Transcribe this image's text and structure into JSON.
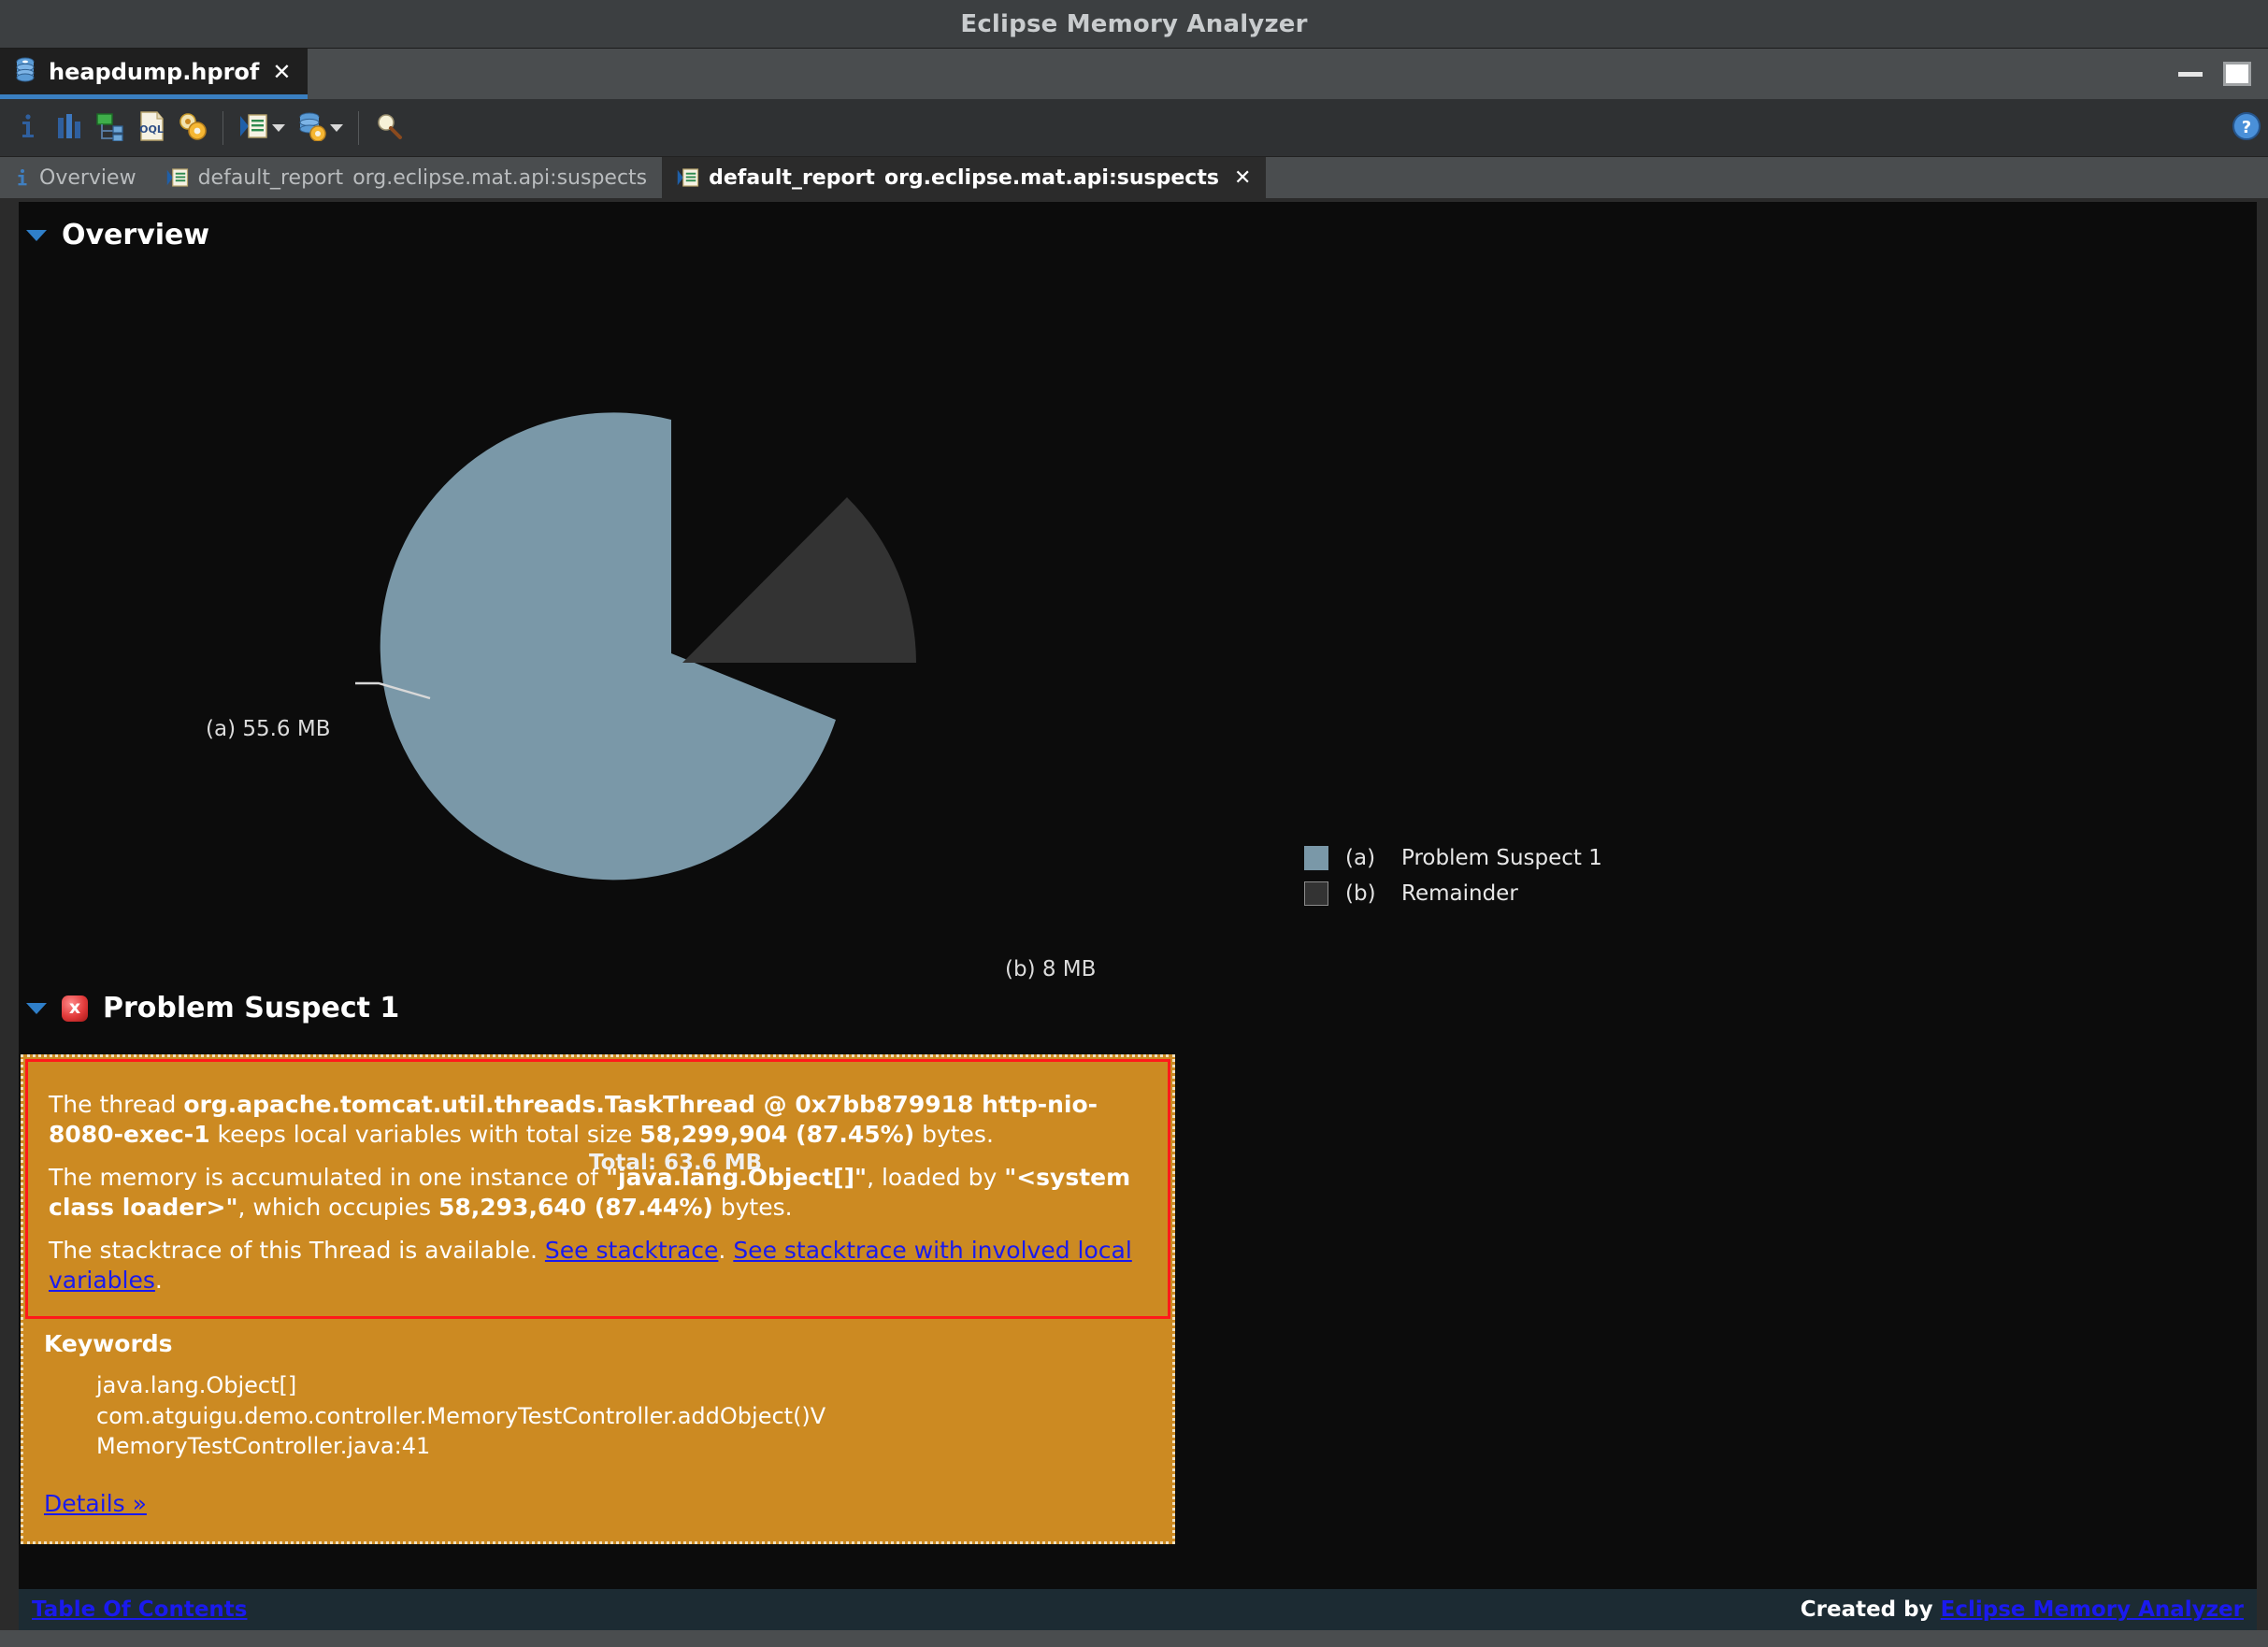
{
  "window": {
    "title": "Eclipse Memory Analyzer",
    "minimize_icon": "minimize-icon",
    "maximize_icon": "maximize-icon"
  },
  "file_tab": {
    "label": "heapdump.hprof",
    "icon": "heapdump-icon",
    "close_label": "✕"
  },
  "toolbar": {
    "buttons": [
      {
        "name": "heap-dump-overview-button",
        "icon": "info-icon",
        "label": "i"
      },
      {
        "name": "histogram-button",
        "icon": "histogram-icon",
        "label": ""
      },
      {
        "name": "dominator-tree-button",
        "icon": "dominator-tree-icon",
        "label": ""
      },
      {
        "name": "oql-button",
        "icon": "oql-icon",
        "label": "OQL"
      },
      {
        "name": "run-expert-system-test-button",
        "icon": "gears-icon",
        "label": ""
      },
      {
        "name": "open-query-browser-button",
        "icon": "query-browser-icon",
        "label": ""
      },
      {
        "name": "run-report-button",
        "icon": "heapdump-gear-icon",
        "label": ""
      },
      {
        "name": "find-button",
        "icon": "magnifier-icon",
        "label": ""
      }
    ],
    "help_icon": "help-icon"
  },
  "report_tabs": [
    {
      "name": "tab-overview",
      "icon": "info-icon",
      "title": "Overview",
      "subtitle": "",
      "active": false,
      "closable": false
    },
    {
      "name": "tab-default-report-1",
      "icon": "report-icon",
      "title": "default_report",
      "subtitle": "org.eclipse.mat.api:suspects",
      "active": false,
      "closable": false
    },
    {
      "name": "tab-default-report-2",
      "icon": "report-icon",
      "title": "default_report",
      "subtitle": "org.eclipse.mat.api:suspects",
      "active": true,
      "closable": true,
      "close_label": "✕"
    }
  ],
  "overview": {
    "heading": "Overview"
  },
  "chart_data": {
    "type": "pie",
    "title": "",
    "total_label": "Total: 63.6 MB",
    "total_mb": 63.6,
    "categories": [
      "Problem Suspect 1",
      "Remainder"
    ],
    "keys": [
      "(a)",
      "(b)"
    ],
    "values": [
      55.6,
      8
    ],
    "value_labels": [
      "55.6 MB",
      "8 MB"
    ],
    "callout_labels": [
      "(a)  55.6 MB",
      "(b)  8 MB"
    ],
    "colors": [
      "#7a98a8",
      "#333333"
    ],
    "legend_position": "right",
    "legend": [
      {
        "key": "(a)",
        "label": "Problem Suspect 1",
        "color": "#7a98a8"
      },
      {
        "key": "(b)",
        "label": "Remainder",
        "color": "#333333"
      }
    ],
    "exploded_slice": "Remainder",
    "units": "MB"
  },
  "suspect": {
    "heading": "Problem Suspect 1",
    "error_icon": "error-icon",
    "error_glyph": "x",
    "paragraph1": {
      "t1": "The thread ",
      "b1": "org.apache.tomcat.util.threads.TaskThread @ 0x7bb879918 http-nio-8080-exec-1",
      "t2": " keeps local variables with total size ",
      "b2": "58,299,904 (87.45%)",
      "t3": " bytes."
    },
    "paragraph2": {
      "t1": "The memory is accumulated in one instance of ",
      "b1": "\"java.lang.Object[]\"",
      "t2": ", loaded by ",
      "b2": "\"<system class loader>\"",
      "t3": ", which occupies ",
      "b3": "58,293,640 (87.44%)",
      "t4": " bytes."
    },
    "paragraph3": {
      "t1": "The stacktrace of this Thread is available. ",
      "link1": "See stacktrace",
      "t2": ". ",
      "link2": "See stacktrace with involved local variables",
      "t3": "."
    },
    "keywords_heading": "Keywords",
    "keywords": [
      "java.lang.Object[]",
      "com.atguigu.demo.controller.MemoryTestController.addObject()V",
      "MemoryTestController.java:41"
    ],
    "details_link": "Details »"
  },
  "footer": {
    "toc_link": "Table Of Contents",
    "created_by_prefix": "Created by ",
    "created_by_link": "Eclipse Memory Analyzer"
  },
  "colors": {
    "suspect_box_bg": "#cc8a22",
    "suspect_box_border": "#ff1a1a",
    "link": "#1a1aee",
    "accent_tab": "#3a7fc1",
    "pie_a": "#7a98a8",
    "pie_b": "#333333"
  }
}
